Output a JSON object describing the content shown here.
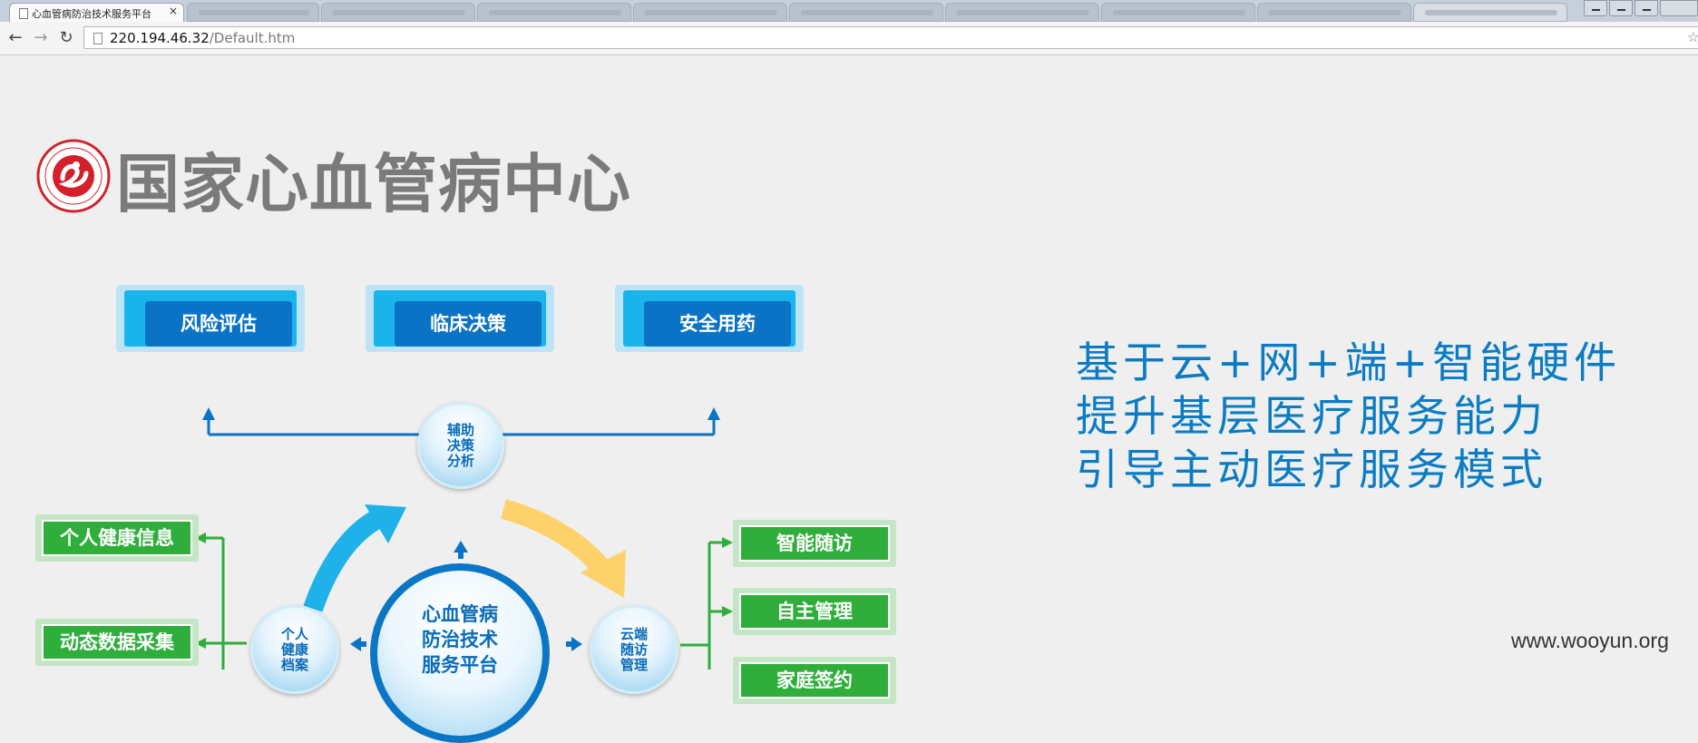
{
  "browser": {
    "active_tab_title": "心血管病防治技术服务平台",
    "tab_close": "×",
    "url_host": "220.194.46.32",
    "url_path": "/Default.htm",
    "back": "←",
    "forward": "→",
    "reload": "↻",
    "star": "☆"
  },
  "site": {
    "title": "国家心血管病中心"
  },
  "diagram": {
    "top_buttons": [
      "风险评估",
      "临床决策",
      "安全用药"
    ],
    "left_buttons": [
      "个人健康信息",
      "动态数据采集"
    ],
    "right_buttons": [
      "智能随访",
      "自主管理",
      "家庭签约"
    ],
    "center": "心血管病\n防治技术\n服务平台",
    "circle_top": "辅助\n决策\n分析",
    "circle_left": "个人\n健康\n档案",
    "circle_right": "云端\n随访\n管理"
  },
  "slogan": {
    "line1": "基于云+网+端+智能硬件",
    "line2": "提升基层医疗服务能力",
    "line3": "引导主动医疗服务模式"
  },
  "watermark": "www.wooyun.org",
  "colors": {
    "blue": "#0b73c6",
    "sky": "#19b5ea",
    "green": "#2fae3c",
    "yellow": "#fdd26a",
    "title_grey": "#7a7a7a",
    "slogan_blue": "#0b7cc3"
  }
}
